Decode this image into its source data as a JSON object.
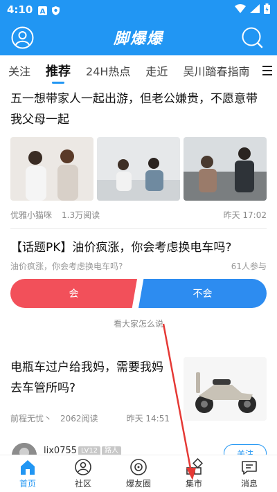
{
  "status": {
    "time": "4:10"
  },
  "header": {
    "title": "脚爆爆"
  },
  "tabs": [
    "关注",
    "推荐",
    "24H热点",
    "走近",
    "吴川踏春指南"
  ],
  "post1": {
    "title": "五一想带家人一起出游，但老公嫌贵，不愿意带我父母一起",
    "author": "优雅小猫咪",
    "reads": "1.3万阅读",
    "time": "昨天 17:02"
  },
  "poll": {
    "title": "【话题PK】油价疯涨，你会考虑换电车吗?",
    "subtitle": "油价疯涨，你会考虑换电车吗?",
    "participants": "61人参与",
    "yes_label": "会",
    "no_label": "不会",
    "more": "看大家怎么说"
  },
  "post2": {
    "title": "电瓶车过户给我妈，需要我妈去车管所吗?",
    "author": "前程无忧丶",
    "reads": "2062阅读",
    "time": "昨天 14:51"
  },
  "post3": {
    "username": "lix0755",
    "level": "LV12",
    "role": "路人",
    "follow": "关注"
  },
  "nav": {
    "home": "首页",
    "community": "社区",
    "friends": "爆友圈",
    "market": "集市",
    "messages": "消息"
  },
  "colors": {
    "brand": "#2196f3",
    "poll_yes": "#f2505a",
    "poll_no": "#2d8cf0",
    "annotation": "#e53935"
  }
}
